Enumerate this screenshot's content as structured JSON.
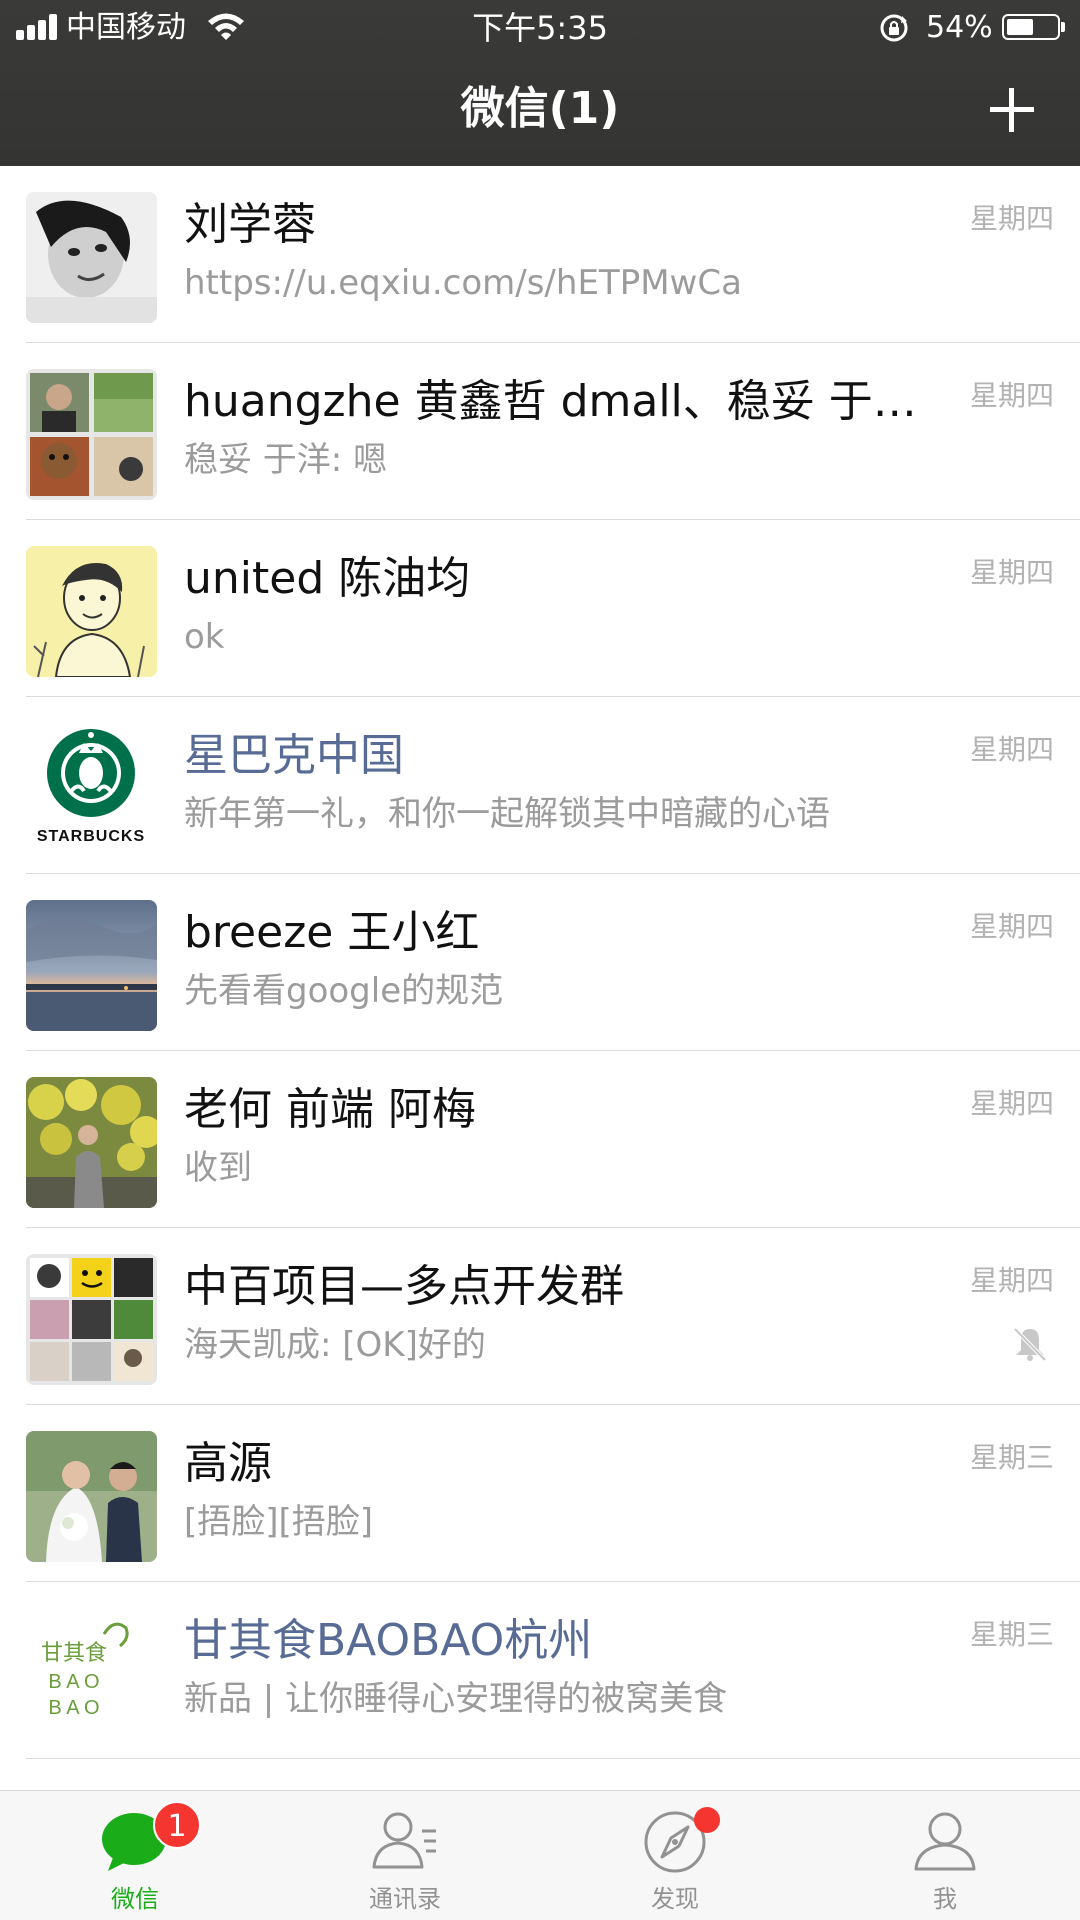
{
  "status_bar": {
    "carrier": "中国移动",
    "time": "下午5:35",
    "battery": "54%",
    "battery_level": 0.54
  },
  "nav": {
    "title": "微信(1)",
    "icons": {
      "add": "plus-icon"
    }
  },
  "colors": {
    "nav_bg": "#363634",
    "accent": "#1aad19",
    "official_name": "#576b95",
    "preview": "#9b9b9b",
    "badge": "#f43530"
  },
  "chats": [
    {
      "name": "刘学蓉",
      "preview": "https://u.eqxiu.com/s/hETPMwCa",
      "time": "星期四",
      "official": false,
      "muted": false
    },
    {
      "name": "huangzhe 黄鑫哲 dmall、稳妥 于洋…",
      "preview": "稳妥 于洋: 嗯",
      "time": "星期四",
      "official": false,
      "muted": false
    },
    {
      "name": "united 陈油均",
      "preview": "ok",
      "time": "星期四",
      "official": false,
      "muted": false
    },
    {
      "name": "星巴克中国",
      "preview": "新年第一礼，和你一起解锁其中暗藏的心语",
      "time": "星期四",
      "official": true,
      "muted": false,
      "avatar_text": "STARBUCKS"
    },
    {
      "name": "breeze 王小红",
      "preview": "先看看google的规范",
      "time": "星期四",
      "official": false,
      "muted": false
    },
    {
      "name": "老何 前端 阿梅",
      "preview": "收到",
      "time": "星期四",
      "official": false,
      "muted": false
    },
    {
      "name": "中百项目—多点开发群",
      "preview": "海天凯成: [OK]好的",
      "time": "星期四",
      "official": false,
      "muted": true
    },
    {
      "name": "高源",
      "preview": "[捂脸][捂脸]",
      "time": "星期三",
      "official": false,
      "muted": false
    },
    {
      "name": "甘其食BAOBAO杭州",
      "preview": "新品 | 让你睡得心安理得的被窝美食",
      "time": "星期三",
      "official": true,
      "muted": false,
      "avatar_text": [
        "甘其食",
        "B A O",
        "B A O"
      ]
    }
  ],
  "tabbar": {
    "tabs": [
      {
        "label": "微信",
        "icon": "chat-bubble-icon",
        "active": true,
        "badge": "1"
      },
      {
        "label": "通讯录",
        "icon": "contacts-icon",
        "active": false
      },
      {
        "label": "发现",
        "icon": "compass-icon",
        "active": false,
        "dot": true
      },
      {
        "label": "我",
        "icon": "profile-icon",
        "active": false
      }
    ]
  }
}
